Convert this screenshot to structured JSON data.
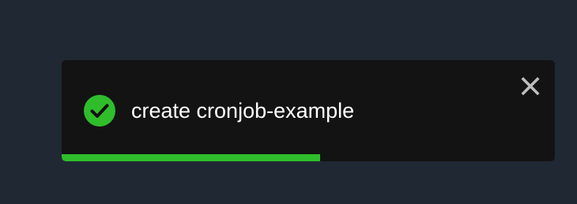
{
  "toast": {
    "status": "success",
    "message": "create cronjob-example",
    "status_icon": "check-circle-icon",
    "close_icon": "close-icon",
    "progress": 0.524,
    "colors": {
      "background": "#131313",
      "text": "#ffffff",
      "success": "#2fbd2c",
      "close": "#bdbdbd"
    }
  },
  "page": {
    "background": "#202833"
  }
}
